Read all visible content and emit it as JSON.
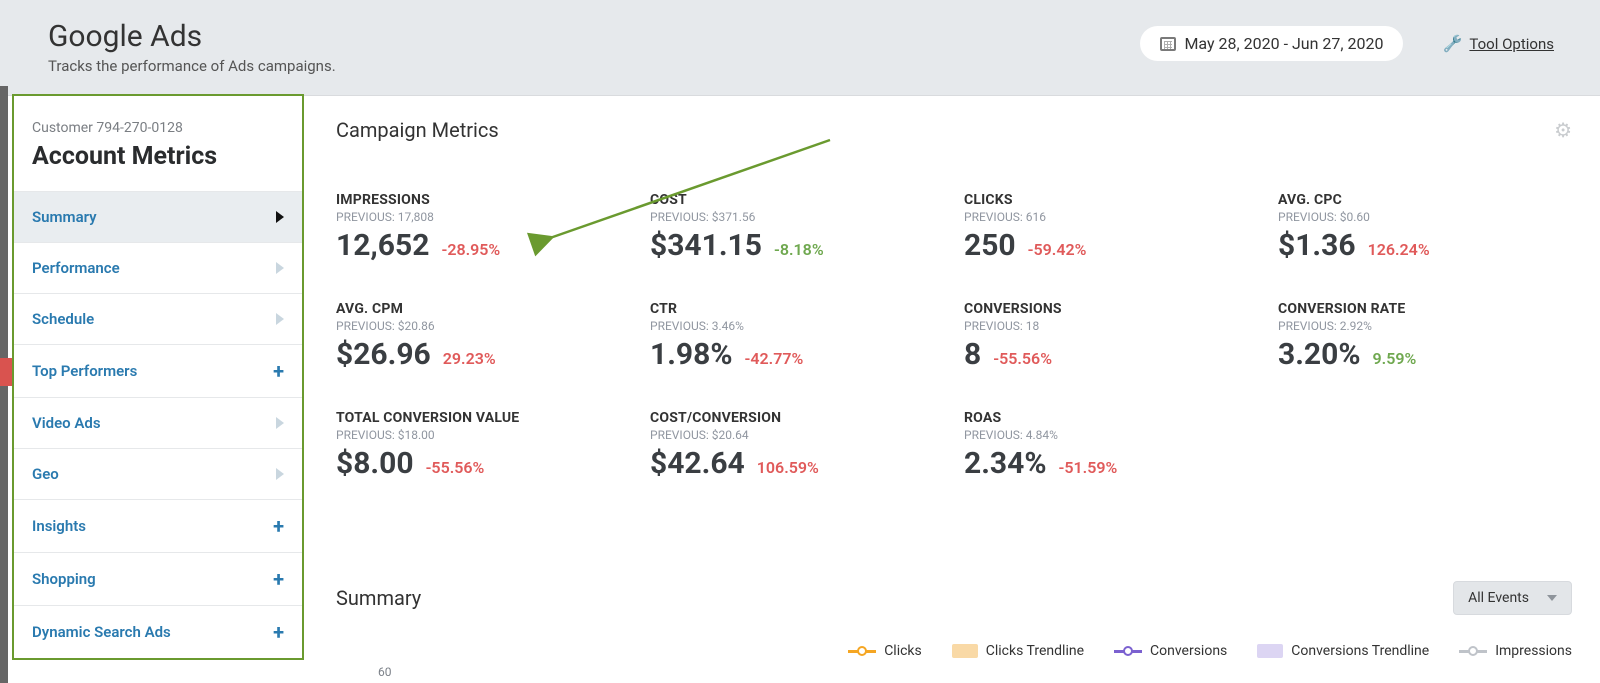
{
  "header": {
    "title": "Google Ads",
    "subtitle": "Tracks the performance of Ads campaigns.",
    "date_range": "May 28, 2020 - Jun 27, 2020",
    "tool_options": "Tool Options"
  },
  "sidebar": {
    "customer_id": "Customer 794-270-0128",
    "title": "Account Metrics",
    "items": [
      {
        "label": "Summary",
        "kind": "chev",
        "active": true
      },
      {
        "label": "Performance",
        "kind": "chev",
        "active": false
      },
      {
        "label": "Schedule",
        "kind": "chev",
        "active": false
      },
      {
        "label": "Top Performers",
        "kind": "plus",
        "active": false
      },
      {
        "label": "Video Ads",
        "kind": "chev",
        "active": false
      },
      {
        "label": "Geo",
        "kind": "chev",
        "active": false
      },
      {
        "label": "Insights",
        "kind": "plus",
        "active": false
      },
      {
        "label": "Shopping",
        "kind": "plus",
        "active": false
      },
      {
        "label": "Dynamic Search Ads",
        "kind": "plus",
        "active": false
      }
    ]
  },
  "main": {
    "section_title": "Campaign Metrics",
    "metrics": [
      {
        "label": "IMPRESSIONS",
        "previous": "PREVIOUS: 17,808",
        "value": "12,652",
        "change": "-28.95%",
        "dir": "neg"
      },
      {
        "label": "COST",
        "previous": "PREVIOUS: $371.56",
        "value": "$341.15",
        "change": "-8.18%",
        "dir": "pos"
      },
      {
        "label": "CLICKS",
        "previous": "PREVIOUS: 616",
        "value": "250",
        "change": "-59.42%",
        "dir": "neg"
      },
      {
        "label": "AVG. CPC",
        "previous": "PREVIOUS: $0.60",
        "value": "$1.36",
        "change": "126.24%",
        "dir": "neg"
      },
      {
        "label": "AVG. CPM",
        "previous": "PREVIOUS: $20.86",
        "value": "$26.96",
        "change": "29.23%",
        "dir": "neg"
      },
      {
        "label": "CTR",
        "previous": "PREVIOUS: 3.46%",
        "value": "1.98%",
        "change": "-42.77%",
        "dir": "neg"
      },
      {
        "label": "CONVERSIONS",
        "previous": "PREVIOUS: 18",
        "value": "8",
        "change": "-55.56%",
        "dir": "neg"
      },
      {
        "label": "CONVERSION RATE",
        "previous": "PREVIOUS: 2.92%",
        "value": "3.20%",
        "change": "9.59%",
        "dir": "pos"
      },
      {
        "label": "TOTAL CONVERSION VALUE",
        "previous": "PREVIOUS: $18.00",
        "value": "$8.00",
        "change": "-55.56%",
        "dir": "neg"
      },
      {
        "label": "COST/CONVERSION",
        "previous": "PREVIOUS: $20.64",
        "value": "$42.64",
        "change": "106.59%",
        "dir": "neg"
      },
      {
        "label": "ROAS",
        "previous": "PREVIOUS: 4.84%",
        "value": "2.34%",
        "change": "-51.59%",
        "dir": "neg"
      }
    ],
    "summary_title": "Summary",
    "dropdown": "All Events",
    "legend": [
      "Clicks",
      "Clicks Trendline",
      "Conversions",
      "Conversions Trendline",
      "Impressions"
    ],
    "colors": {
      "clicks": "#f5a623",
      "clicks_tl": "#f9d9a6",
      "conv": "#7b61d0",
      "conv_tl": "#dcd5f3",
      "impr": "#bfc3c9"
    },
    "axis_tick": "60"
  }
}
